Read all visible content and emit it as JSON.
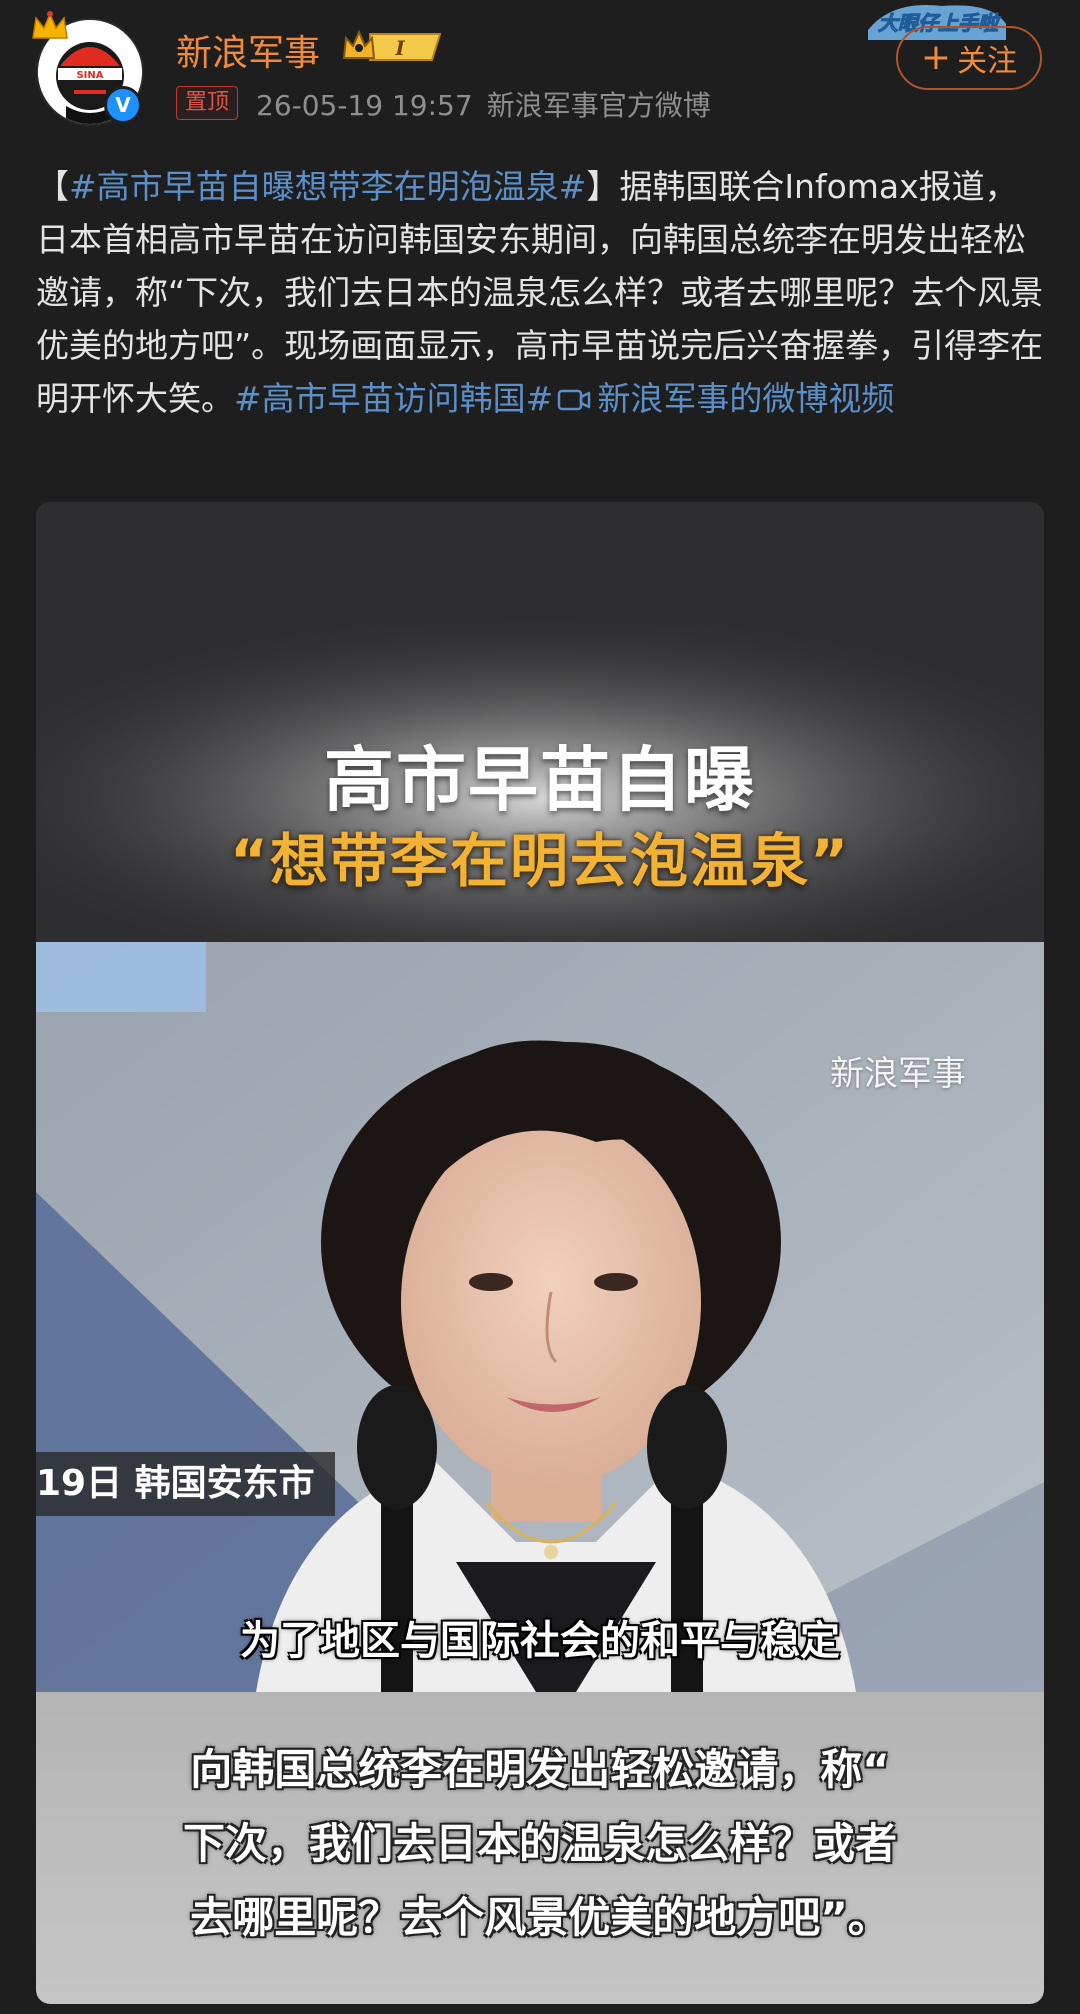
{
  "header": {
    "username": "新浪军事",
    "vip_level": "I",
    "pin_label": "置顶",
    "timestamp": "26-05-19 19:57",
    "source": "新浪军事官方微博",
    "follow_label": "关注",
    "follow_plus": "+",
    "verified_mark": "V",
    "sticker_text": "大眼仔上手啦"
  },
  "post": {
    "bracket_open": "【",
    "topic_tag": "#高市早苗自曝想带李在明泡温泉#",
    "bracket_close": "】",
    "body": "据韩国联合Infomax报道，日本首相高市早苗在访问韩国安东期间，向韩国总统李在明发出轻松邀请，称“下次，我们去日本的温泉怎么样？或者去哪里呢？去个风景优美的地方吧”。现场画面显示，高市早苗说完后兴奋握拳，引得李在明开怀大笑。",
    "topic_tag2": "#高市早苗访问韩国#",
    "video_link": "新浪军事的微博视频"
  },
  "video": {
    "title_line1": "高市早苗自曝",
    "title_line2": "“想带李在明去泡温泉”",
    "watermark": "新浪军事",
    "location_tag": "19日 韩国安东市",
    "subtitle": "为了地区与国际社会的和平与稳定",
    "caption_line1": "向韩国总统李在明发出轻松邀请，称“",
    "caption_line2": "下次，我们去日本的温泉怎么样？或者",
    "caption_line3": "去哪里呢？去个风景优美的地方吧”。"
  },
  "colors": {
    "background": "#1e1e1e",
    "username": "#f08a3c",
    "hashtag": "#5b8fc9",
    "meta": "#8e8e8e",
    "title_yellow": "#f2b233"
  },
  "icons": [
    "crown-icon",
    "verified-icon",
    "video-link-icon",
    "plus-icon"
  ]
}
